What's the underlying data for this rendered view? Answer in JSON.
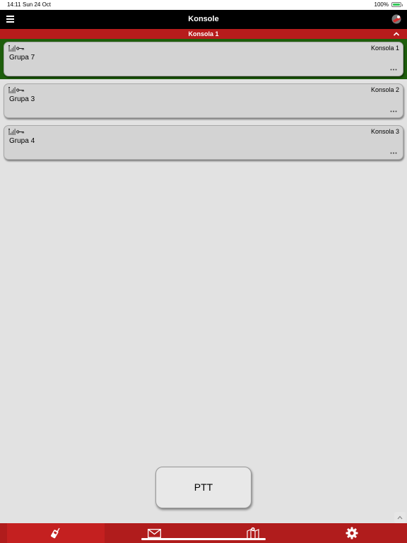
{
  "status_bar": {
    "time": "14:11",
    "date": "Sun 24 Oct",
    "battery": "100%",
    "battery_level": 1.0
  },
  "header": {
    "title": "Konsole",
    "menu_icon": "hamburger-menu-icon",
    "logo_icon": "app-logo-icon"
  },
  "section": {
    "label": "Konsola 1",
    "collapse_icon": "chevron-up-icon"
  },
  "cards": [
    {
      "console": "Konsola 1",
      "group": "Grupa 7",
      "active": true
    },
    {
      "console": "Konsola 2",
      "group": "Grupa 3",
      "active": false
    },
    {
      "console": "Konsola 3",
      "group": "Grupa 4",
      "active": false
    }
  ],
  "ptt": {
    "label": "PTT"
  },
  "tabs": [
    {
      "icon": "radio-icon",
      "active": true
    },
    {
      "icon": "envelope-icon",
      "active": false
    },
    {
      "icon": "map-icon",
      "active": false
    },
    {
      "icon": "gear-icon",
      "active": false
    }
  ],
  "colors": {
    "header_bg": "#000000",
    "section_bg": "#b71c1c",
    "active_bg": "#1e5e0c",
    "tabbar_bg": "#b01c1c",
    "tab_active_bg": "#c42020"
  }
}
